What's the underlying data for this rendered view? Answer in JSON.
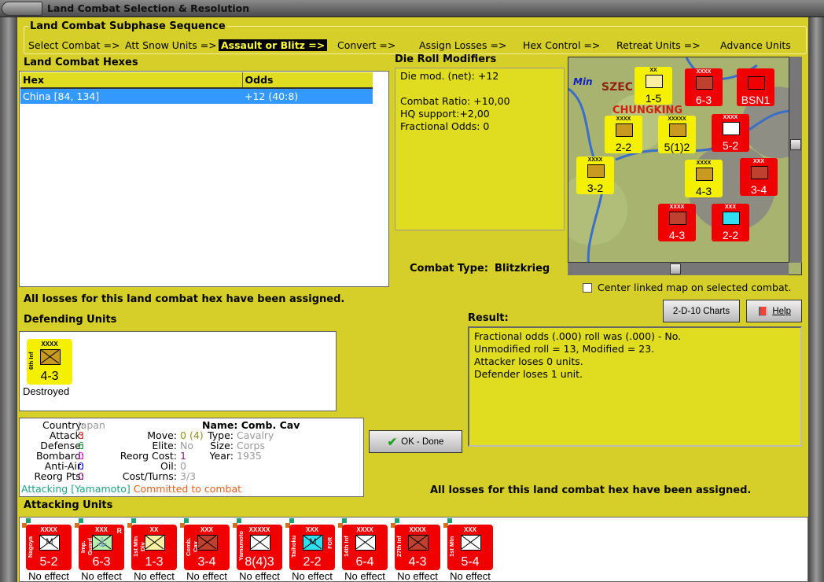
{
  "window": {
    "title": "Land Combat Selection & Resolution"
  },
  "sequence": {
    "title": "Land Combat Subphase Sequence",
    "steps": [
      "Select Combat =>",
      "Att Snow Units =>",
      "Assault or Blitz =>",
      "Convert =>",
      "Assign Losses =>",
      "Hex Control =>",
      "Retreat Units =>",
      "Advance Units"
    ],
    "active_index": 2
  },
  "hexes": {
    "title": "Land Combat Hexes",
    "columns": [
      "Hex",
      "Odds"
    ],
    "rows": [
      {
        "hex": "China [84, 134]",
        "odds": "+12 (40:8)",
        "selected": true
      }
    ]
  },
  "die_roll": {
    "title": "Die Roll Modifiers",
    "lines": [
      "Die mod. (net): +12",
      "",
      "Combat Ratio: +10,00",
      "HQ support:+2,00",
      "Fractional Odds: 0"
    ]
  },
  "combat_type": {
    "label": "Combat Type:",
    "value": "Blitzkrieg"
  },
  "center_map": {
    "label": "Center linked map on selected combat.",
    "checked": false
  },
  "losses_message": "All losses for this land combat hex have been assigned.",
  "buttons": {
    "charts": "2-D-10 Charts",
    "help": "Help",
    "ok": "OK - Done"
  },
  "defending": {
    "title": "Defending Units",
    "units": [
      {
        "name": "6th Inf",
        "size": "XXXX",
        "value": "4-3",
        "color": "#f4f000",
        "sym": "#c89a20",
        "status": "Destroyed"
      }
    ]
  },
  "result": {
    "title": "Result:",
    "lines": [
      "Fractional odds (.000) roll was (.000)  - No.",
      "Unmodified roll = 13, Modified = 23.",
      "Attacker loses 0 units.",
      "Defender loses 1 unit."
    ]
  },
  "info": {
    "country_label": "Country:",
    "country": "Japan",
    "attack_label": "Attack:",
    "attack": "3",
    "defense_label": "Defense:",
    "defense": "6",
    "bombard_label": "Bombard:",
    "bombard": "0",
    "antiair_label": "Anti-Air:",
    "antiair": "0",
    "reorg_pts_label": "Reorg Pts:",
    "reorg_pts": "0",
    "move_label": "Move:",
    "move": "0",
    "move_extra": "(4)",
    "elite_label": "Elite:",
    "elite": "No",
    "reorg_cost_label": "Reorg Cost:",
    "reorg_cost": "1",
    "oil_label": "Oil:",
    "oil": "0",
    "cost_turns_label": "Cost/Turns:",
    "cost_turns": "3/3",
    "name": "Name: Comb. Cav",
    "type_label": "Type:",
    "type": "Cavalry",
    "size_label": "Size:",
    "size": "Corps",
    "year_label": "Year:",
    "year": "1935",
    "attacking": "Attacking [Yamamoto]",
    "committed": "Committed to combat"
  },
  "attacking": {
    "title": "Attacking Units",
    "units": [
      {
        "name": "Nagoya",
        "size": "XXXX",
        "value": "5-2",
        "sym": "#ffffff",
        "mark": "M",
        "flag": "",
        "side": "",
        "status": "No effect"
      },
      {
        "name": "Imp. Guard",
        "size": "XXX",
        "value": "6-3",
        "sym": "#b8f0b0",
        "mark": "⚓",
        "flag": "R",
        "side": "",
        "status": "No effect"
      },
      {
        "name": "1st Mtn Div",
        "size": "XX",
        "value": "1-3",
        "sym": "#f8f0a0",
        "mark": "",
        "flag": "",
        "side": "",
        "status": "No effect"
      },
      {
        "name": "Comb. Cav",
        "size": "XXX",
        "value": "3-4",
        "sym": "#c04030",
        "mark": "",
        "flag": "",
        "side": "",
        "status": "No effect"
      },
      {
        "name": "Yamamoto",
        "size": "XXXXX",
        "value": "8(4)3",
        "sym": "#ffffff",
        "mark": "",
        "flag": "",
        "side": "",
        "status": "No effect"
      },
      {
        "name": "Taihoku",
        "size": "XXX",
        "value": "2-2",
        "sym": "#30e0f0",
        "mark": "M",
        "flag": "",
        "side": "FOR",
        "status": "No effect"
      },
      {
        "name": "14th Inf",
        "size": "XXXX",
        "value": "6-4",
        "sym": "#ffffff",
        "mark": "",
        "flag": "",
        "side": "",
        "status": "No effect"
      },
      {
        "name": "27th Inf",
        "size": "XXXX",
        "value": "4-3",
        "sym": "#c04030",
        "mark": "",
        "flag": "",
        "side": "",
        "status": "No effect"
      },
      {
        "name": "1st Mtn",
        "size": "XXX",
        "value": "5-4",
        "sym": "#ffffff",
        "mark": "",
        "flag": "",
        "side": "",
        "status": "No effect"
      }
    ]
  },
  "map": {
    "labels": [
      "Min",
      "SZEC",
      "CHUNGKING"
    ],
    "units": [
      {
        "size": "XX",
        "value": "1-5",
        "color": "#f4f000",
        "sym": "#f8f0a0"
      },
      {
        "size": "XXXX",
        "value": "6-3",
        "color": "#f00000",
        "sym": "#c04030"
      },
      {
        "size": "",
        "value": "BSN1",
        "color": "#f00000",
        "sym": "#f00000"
      },
      {
        "size": "XXXX",
        "value": "2-2",
        "color": "#f4f000",
        "sym": "#c89a20"
      },
      {
        "size": "XXXXX",
        "value": "5(1)2",
        "color": "#f4f000",
        "sym": "#c89a20"
      },
      {
        "size": "XXXX",
        "value": "5-2",
        "color": "#f00000",
        "sym": "#ffffff"
      },
      {
        "size": "XXXX",
        "value": "3-2",
        "color": "#f4f000",
        "sym": "#c89a20"
      },
      {
        "size": "XXXX",
        "value": "4-3",
        "color": "#f4f000",
        "sym": "#c89a20"
      },
      {
        "size": "XXX",
        "value": "3-4",
        "color": "#f00000",
        "sym": "#c04030"
      },
      {
        "size": "XXXX",
        "value": "4-3",
        "color": "#f00000",
        "sym": "#c04030"
      },
      {
        "size": "XXX",
        "value": "2-2",
        "color": "#f00000",
        "sym": "#30e0f0"
      }
    ]
  }
}
